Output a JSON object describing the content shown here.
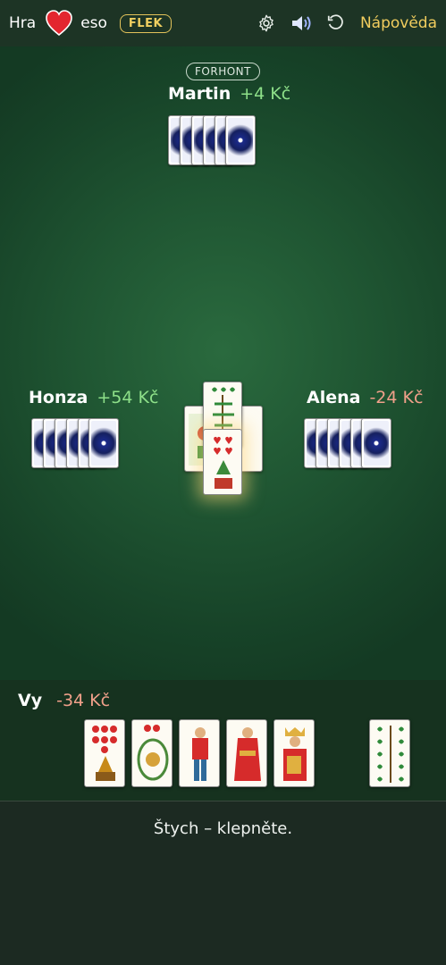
{
  "header": {
    "title_left": "Hra",
    "title_right": "eso",
    "flek_label": "FLEK",
    "help_label": "Nápověda",
    "icons": [
      "heart-icon",
      "gear-icon",
      "speaker-icon",
      "undo-icon"
    ]
  },
  "players": {
    "top": {
      "badge": "FORHONT",
      "name": "Martin",
      "score": "+4 Kč",
      "cards": 6
    },
    "left": {
      "name": "Honza",
      "score": "+54 Kč",
      "cards": 6
    },
    "right": {
      "name": "Alena",
      "score": "-24 Kč",
      "cards": 6
    },
    "me": {
      "name": "Vy",
      "score": "-34 Kč"
    }
  },
  "trick": [
    "zelený 9",
    "červený 7",
    "zelený 8",
    "červený 5"
  ],
  "hand": [
    "červený 7",
    "červené eso",
    "červený spodek",
    "červený svršek",
    "červený král",
    "zelený 10"
  ],
  "status": "Štych – klepněte.",
  "colors": {
    "accent": "#f0cf60",
    "positive": "#8ee089",
    "negative": "#f0a08a",
    "red": "#d62b2b",
    "green": "#2f8a3a"
  }
}
